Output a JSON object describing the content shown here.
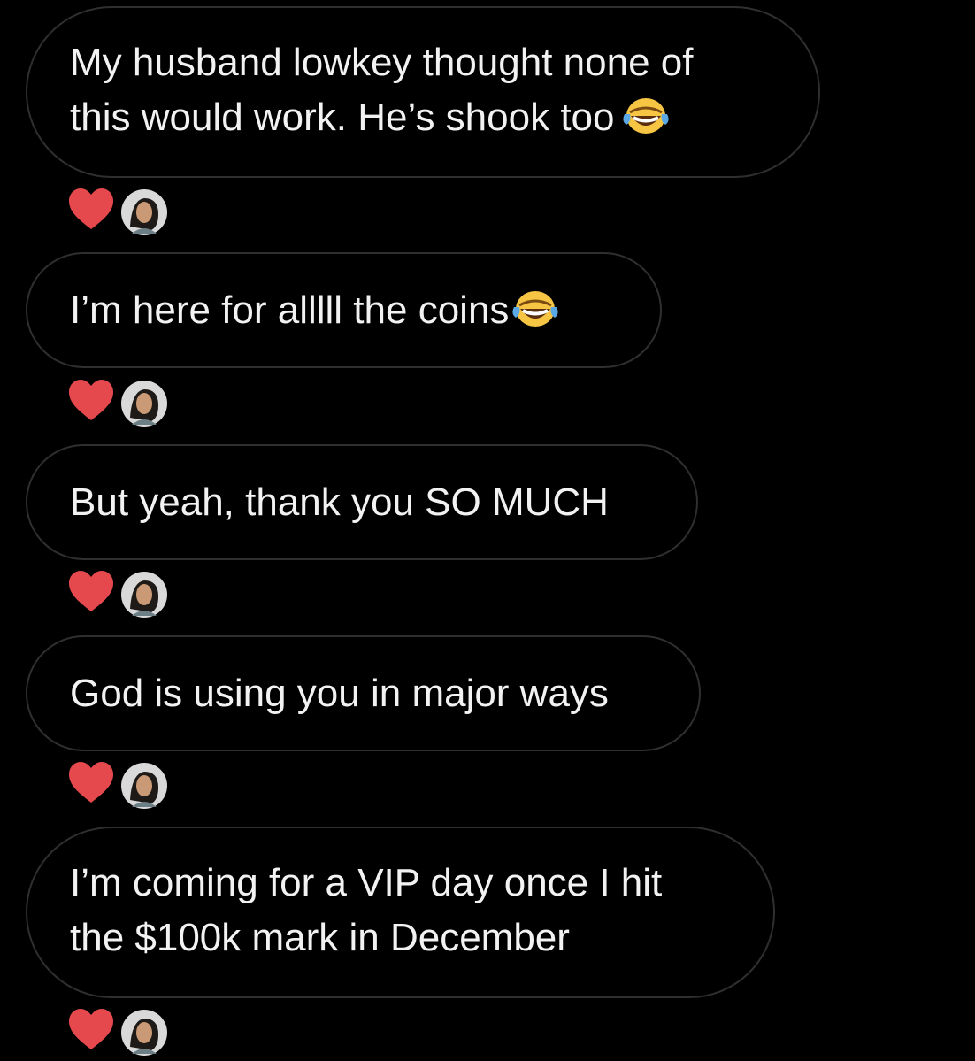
{
  "colors": {
    "background": "#000000",
    "bubble_border": "#2f2f2f",
    "text": "#f2f2f2",
    "heart": "#e5484d"
  },
  "messages": [
    {
      "text": "My husband lowkey thought none of\nthis would work. He’s shook too",
      "emoji": "tears-of-joy-emoji",
      "reaction": "heart",
      "reactor": "avatar"
    },
    {
      "text": "I’m here for alllll the coins",
      "emoji": "tears-of-joy-emoji",
      "reaction": "heart",
      "reactor": "avatar"
    },
    {
      "text": "But yeah, thank you SO MUCH",
      "emoji": null,
      "reaction": "heart",
      "reactor": "avatar"
    },
    {
      "text": "God is using you in major ways",
      "emoji": null,
      "reaction": "heart",
      "reactor": "avatar"
    },
    {
      "text": "I’m coming for a VIP day once I hit\nthe $100k mark in December",
      "emoji": null,
      "reaction": "heart",
      "reactor": "avatar"
    }
  ]
}
